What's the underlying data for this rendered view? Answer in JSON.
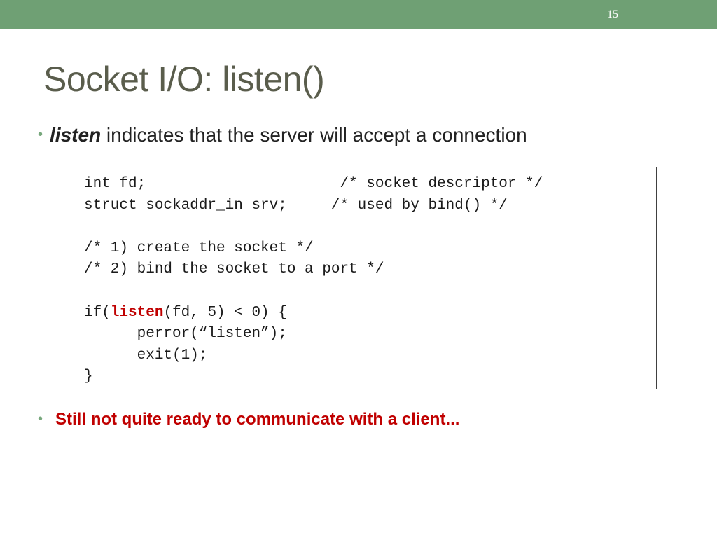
{
  "slide": {
    "number": "15",
    "title": "Socket I/O: listen()"
  },
  "colors": {
    "header_bar": "#6fa074",
    "title_text": "#5a5d4c",
    "highlight": "#c00000",
    "bullet": "#78a87d"
  },
  "bullets": [
    {
      "keyword": "listen",
      "text": " indicates that the server will accept a connection"
    },
    {
      "text": "Still not quite ready to communicate with a client..."
    }
  ],
  "code": {
    "line1": "int fd;                      /* socket descriptor */",
    "line2": "struct sockaddr_in srv;     /* used by bind() */",
    "line3": "",
    "line4": "/* 1) create the socket */",
    "line5": "/* 2) bind the socket to a port */",
    "line6": "",
    "line7_prefix": "if(",
    "line7_keyword": "listen",
    "line7_suffix": "(fd, 5) < 0) {",
    "line8": "      perror(“listen”);",
    "line9": "      exit(1);",
    "line10": "}"
  }
}
